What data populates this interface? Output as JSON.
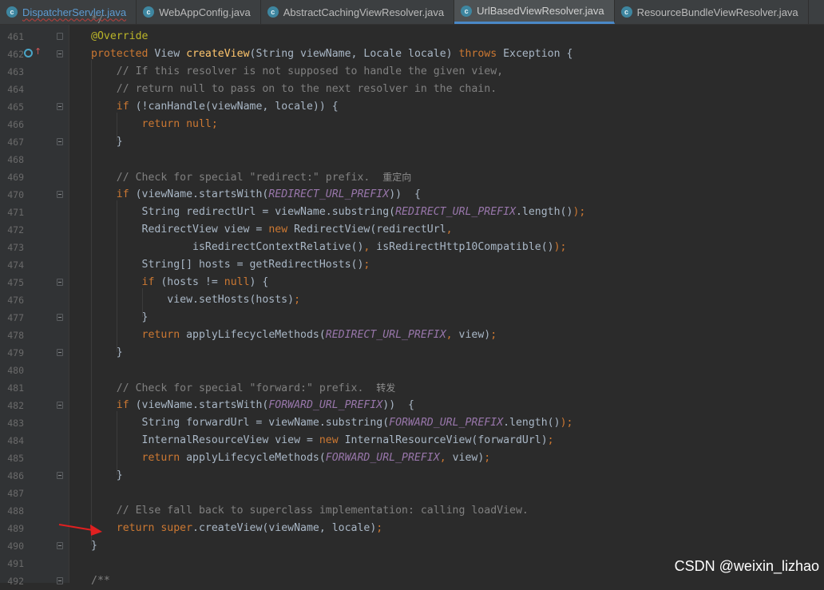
{
  "tabs": [
    {
      "label": "DispatcherServlet.java",
      "icon": "java-class-icon",
      "active": false,
      "error": true
    },
    {
      "label": "WebAppConfig.java",
      "icon": "java-class-icon",
      "active": false,
      "error": false
    },
    {
      "label": "AbstractCachingViewResolver.java",
      "icon": "java-class-icon",
      "active": false,
      "error": false
    },
    {
      "label": "UrlBasedViewResolver.java",
      "icon": "java-class-icon",
      "active": true,
      "error": false
    },
    {
      "label": "ResourceBundleViewResolver.java",
      "icon": "java-class-icon",
      "active": false,
      "error": false
    }
  ],
  "lines": [
    {
      "n": "461",
      "tokens": [
        [
          "an",
          "@Override"
        ]
      ]
    },
    {
      "n": "462",
      "marker": "override-method-icon",
      "tokens": [
        [
          "kw",
          "protected "
        ],
        [
          "",
          "View "
        ],
        [
          "fn",
          "createView"
        ],
        [
          "",
          "(String viewName, Locale locale) "
        ],
        [
          "kw",
          "throws "
        ],
        [
          "",
          "Exception {"
        ]
      ]
    },
    {
      "n": "463",
      "tokens": [
        [
          "cm",
          "    // If this resolver is not supposed to handle the given view,"
        ]
      ]
    },
    {
      "n": "464",
      "tokens": [
        [
          "cm",
          "    // return null to pass on to the next resolver in the chain."
        ]
      ]
    },
    {
      "n": "465",
      "tokens": [
        [
          "",
          "    "
        ],
        [
          "kw",
          "if "
        ],
        [
          "",
          "(!canHandle(viewName, locale)) {"
        ]
      ]
    },
    {
      "n": "466",
      "tokens": [
        [
          "",
          "        "
        ],
        [
          "kw",
          "return null;"
        ]
      ]
    },
    {
      "n": "467",
      "tokens": [
        [
          "",
          "    }"
        ]
      ]
    },
    {
      "n": "468",
      "tokens": []
    },
    {
      "n": "469",
      "tokens": [
        [
          "cm",
          "    // Check for special \"redirect:\" prefix.  "
        ],
        [
          "cjk",
          "重定向"
        ]
      ]
    },
    {
      "n": "470",
      "tokens": [
        [
          "",
          "    "
        ],
        [
          "kw",
          "if "
        ],
        [
          "",
          "(viewName.startsWith("
        ],
        [
          "cn",
          "REDIRECT_URL_PREFIX"
        ],
        [
          "",
          "))  {"
        ]
      ]
    },
    {
      "n": "471",
      "tokens": [
        [
          "",
          "        String redirectUrl = viewName.substring("
        ],
        [
          "cn",
          "REDIRECT_URL_PREFIX"
        ],
        [
          "",
          ".length()"
        ],
        [
          "kw",
          ");"
        ]
      ]
    },
    {
      "n": "472",
      "tokens": [
        [
          "",
          "        RedirectView view = "
        ],
        [
          "kw",
          "new "
        ],
        [
          "",
          "RedirectView(redirectUrl"
        ],
        [
          "kw",
          ","
        ]
      ]
    },
    {
      "n": "473",
      "tokens": [
        [
          "",
          "                isRedirectContextRelative()"
        ],
        [
          "kw",
          ", "
        ],
        [
          "",
          "isRedirectHttp10Compatible()"
        ],
        [
          "kw",
          ");"
        ]
      ]
    },
    {
      "n": "474",
      "tokens": [
        [
          "",
          "        String[] hosts = getRedirectHosts()"
        ],
        [
          "kw",
          ";"
        ]
      ]
    },
    {
      "n": "475",
      "tokens": [
        [
          "",
          "        "
        ],
        [
          "kw",
          "if "
        ],
        [
          "",
          "(hosts != "
        ],
        [
          "kw",
          "null"
        ],
        [
          "",
          ") {"
        ]
      ]
    },
    {
      "n": "476",
      "tokens": [
        [
          "",
          "            view.setHosts(hosts)"
        ],
        [
          "kw",
          ";"
        ]
      ]
    },
    {
      "n": "477",
      "tokens": [
        [
          "",
          "        }"
        ]
      ]
    },
    {
      "n": "478",
      "tokens": [
        [
          "",
          "        "
        ],
        [
          "kw",
          "return "
        ],
        [
          "",
          "applyLifecycleMethods("
        ],
        [
          "cn",
          "REDIRECT_URL_PREFIX"
        ],
        [
          "kw",
          ", "
        ],
        [
          "",
          "view)"
        ],
        [
          "kw",
          ";"
        ]
      ]
    },
    {
      "n": "479",
      "tokens": [
        [
          "",
          "    }"
        ]
      ]
    },
    {
      "n": "480",
      "tokens": []
    },
    {
      "n": "481",
      "tokens": [
        [
          "cm",
          "    // Check for special \"forward:\" prefix.  "
        ],
        [
          "cjk",
          "转发"
        ]
      ]
    },
    {
      "n": "482",
      "tokens": [
        [
          "",
          "    "
        ],
        [
          "kw",
          "if "
        ],
        [
          "",
          "(viewName.startsWith("
        ],
        [
          "cn",
          "FORWARD_URL_PREFIX"
        ],
        [
          "",
          "))  {"
        ]
      ]
    },
    {
      "n": "483",
      "tokens": [
        [
          "",
          "        String forwardUrl = viewName.substring("
        ],
        [
          "cn",
          "FORWARD_URL_PREFIX"
        ],
        [
          "",
          ".length()"
        ],
        [
          "kw",
          ");"
        ]
      ]
    },
    {
      "n": "484",
      "tokens": [
        [
          "",
          "        InternalResourceView view = "
        ],
        [
          "kw",
          "new "
        ],
        [
          "",
          "InternalResourceView(forwardUrl)"
        ],
        [
          "kw",
          ";"
        ]
      ]
    },
    {
      "n": "485",
      "tokens": [
        [
          "",
          "        "
        ],
        [
          "kw",
          "return "
        ],
        [
          "",
          "applyLifecycleMethods("
        ],
        [
          "cn",
          "FORWARD_URL_PREFIX"
        ],
        [
          "kw",
          ", "
        ],
        [
          "",
          "view)"
        ],
        [
          "kw",
          ";"
        ]
      ]
    },
    {
      "n": "486",
      "tokens": [
        [
          "",
          "    }"
        ]
      ]
    },
    {
      "n": "487",
      "tokens": []
    },
    {
      "n": "488",
      "tokens": [
        [
          "cm",
          "    // Else fall back to superclass implementation: calling loadView."
        ]
      ]
    },
    {
      "n": "489",
      "tokens": [
        [
          "",
          "    "
        ],
        [
          "kw",
          "return super"
        ],
        [
          "",
          ".createView(viewName, locale)"
        ],
        [
          "kw",
          ";"
        ]
      ]
    },
    {
      "n": "490",
      "tokens": [
        [
          "",
          "}"
        ]
      ]
    },
    {
      "n": "491",
      "tokens": []
    },
    {
      "n": "492",
      "tokens": [
        [
          "cm",
          "/**"
        ]
      ]
    }
  ],
  "folds": {
    "461": false,
    "462": true,
    "465": true,
    "467": true,
    "470": true,
    "475": true,
    "477": true,
    "479": true,
    "482": true,
    "486": true,
    "490": true,
    "492": true
  },
  "watermark": "CSDN @weixin_lizhao",
  "colors": {
    "keyword": "#cc7832",
    "comment": "#808080",
    "annotation": "#bbb529",
    "method": "#ffc66d",
    "constant": "#9876aa",
    "text": "#a9b7c6",
    "background": "#2b2b2b",
    "arrow": "#e02020"
  }
}
